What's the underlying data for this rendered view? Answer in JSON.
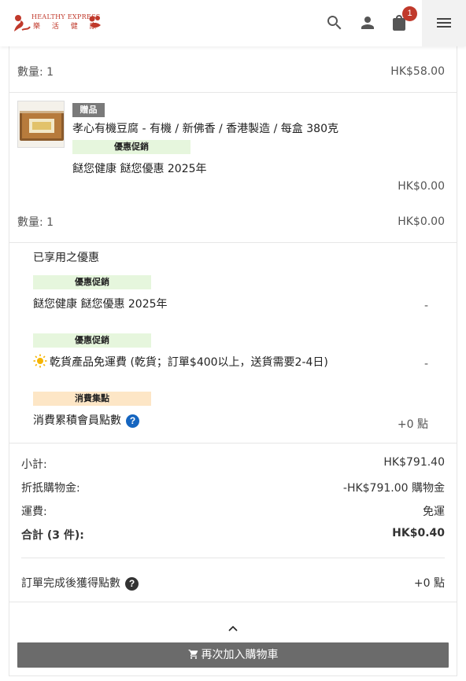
{
  "header": {
    "logo_en": "HEALTHY EXPRESS",
    "logo_zh": "樂 活 健 康",
    "cart_count": "1",
    "icons": [
      "search-icon",
      "account-icon",
      "cart-icon",
      "menu-icon"
    ]
  },
  "item1": {
    "qty_label": "數量: 1",
    "qty_price": "HK$58.00"
  },
  "item2": {
    "gift_tag": "贈品",
    "name": "孝心有機豆腐 - 有機 / 新佛香 / 香港製造 / 每盒 380克",
    "promo_tag": "優惠促銷",
    "promo_name": "餸您健康 餸您優惠 2025年",
    "price": "HK$0.00",
    "qty_label": "數量: 1",
    "qty_price": "HK$0.00"
  },
  "applied": {
    "title": "已享用之優惠",
    "entries": [
      {
        "tag": "優惠促銷",
        "text": "餸您健康 餸您優惠 2025年",
        "value": "-"
      },
      {
        "tag": "優惠促銷",
        "text": "乾貨產品免運費 (乾貨；訂單$400以上，送貨需要2-4日)",
        "value": "-"
      },
      {
        "tag": "消費集點",
        "text": "消費累積會員點數",
        "value": "+0 點"
      }
    ]
  },
  "summary": {
    "subtotal_label": "小計:",
    "subtotal_value": "HK$791.40",
    "credit_label": "折扺購物金:",
    "credit_value": "-HK$791.00 購物金",
    "shipping_label": "運費:",
    "shipping_value": "免運",
    "total_label": "合計 (3 件):",
    "total_value": "HK$0.40",
    "points_label": "訂單完成後獲得點數",
    "points_value": "+0 點"
  },
  "actions": {
    "reorder_label": "再次加入購物車"
  },
  "colors": {
    "brand_red": "#c0392b",
    "promo_tag_bg": "#e6f6dd",
    "points_tag_bg": "#fde6c6",
    "gift_tag_bg": "#7a7a7a",
    "button_bg": "#6b6b6b"
  }
}
